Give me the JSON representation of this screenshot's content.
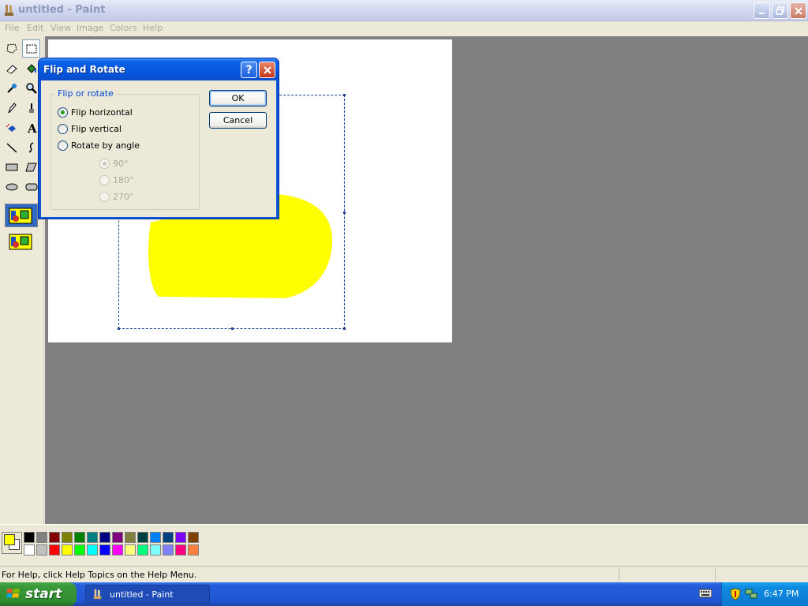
{
  "window": {
    "title": "untitled - Paint",
    "menu": [
      "File",
      "Edit",
      "View",
      "Image",
      "Colors",
      "Help"
    ]
  },
  "tools": [
    {
      "name": "free-form-select-icon"
    },
    {
      "name": "select-icon"
    },
    {
      "name": "eraser-icon"
    },
    {
      "name": "fill-with-color-icon"
    },
    {
      "name": "pick-color-icon"
    },
    {
      "name": "magnifier-icon"
    },
    {
      "name": "pencil-icon"
    },
    {
      "name": "brush-icon"
    },
    {
      "name": "airbrush-icon"
    },
    {
      "name": "text-icon"
    },
    {
      "name": "line-icon"
    },
    {
      "name": "curve-icon"
    },
    {
      "name": "rectangle-icon"
    },
    {
      "name": "polygon-icon"
    },
    {
      "name": "ellipse-icon"
    },
    {
      "name": "rounded-rectangle-icon"
    }
  ],
  "dialog": {
    "title": "Flip and Rotate",
    "group_label": "Flip or rotate",
    "options": [
      {
        "label": "Flip horizontal",
        "checked": true,
        "enabled": true
      },
      {
        "label": "Flip vertical",
        "checked": false,
        "enabled": true
      },
      {
        "label": "Rotate by angle",
        "checked": false,
        "enabled": true
      }
    ],
    "angles": [
      {
        "label": "90°",
        "checked": true
      },
      {
        "label": "180°",
        "checked": false
      },
      {
        "label": "270°",
        "checked": false
      }
    ],
    "ok_label": "OK",
    "cancel_label": "Cancel"
  },
  "palette": {
    "foreground": "#ffff00",
    "background": "#ffffff",
    "row1": [
      "#000000",
      "#808080",
      "#800000",
      "#808000",
      "#008000",
      "#008080",
      "#000080",
      "#800080",
      "#808040",
      "#004040",
      "#0080ff",
      "#004080",
      "#8000ff",
      "#804000"
    ],
    "row2": [
      "#ffffff",
      "#c0c0c0",
      "#ff0000",
      "#ffff00",
      "#00ff00",
      "#00ffff",
      "#0000ff",
      "#ff00ff",
      "#ffff80",
      "#00ff80",
      "#80ffff",
      "#8080ff",
      "#ff0080",
      "#ff8040"
    ]
  },
  "status": {
    "help_text": "For Help, click Help Topics on the Help Menu."
  },
  "taskbar": {
    "start_label": "start",
    "task_label": "untitled - Paint",
    "clock": "6:47 PM"
  },
  "colors": {
    "canvas_blob": "#ffff00",
    "xp_blue": "#0558df",
    "start_green": "#3a9a3a"
  }
}
